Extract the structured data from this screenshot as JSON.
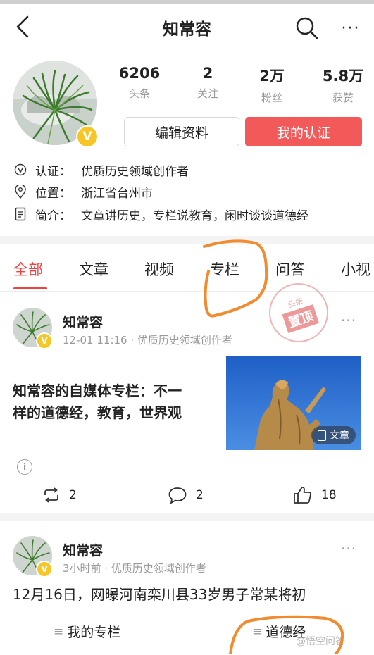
{
  "header": {
    "title": "知常容",
    "back_icon": "chevron-left-icon",
    "search_icon": "search-icon",
    "more_icon": "more-horizontal-icon",
    "more_label": "···"
  },
  "profile": {
    "avatar_badge": "V",
    "stats": [
      {
        "value": "6206",
        "label": "头条"
      },
      {
        "value": "2",
        "label": "关注"
      },
      {
        "value": "2万",
        "label": "粉丝"
      },
      {
        "value": "5.8万",
        "label": "获赞"
      }
    ],
    "edit_button": "编辑资料",
    "cert_button": "我的认证",
    "cert_color": "#f25a5a",
    "info": {
      "cert_key": "认证：",
      "cert_value": "优质历史领域创作者",
      "location_key": "位置：",
      "location_value": "浙江省台州市",
      "bio_key": "简介：",
      "bio_value": "文章讲历史，专栏说教育，闲时谈谈道德经"
    }
  },
  "tabs": [
    {
      "label": "全部",
      "active": true
    },
    {
      "label": "文章",
      "active": false
    },
    {
      "label": "视频",
      "active": false
    },
    {
      "label": "专栏",
      "active": false
    },
    {
      "label": "问答",
      "active": false
    },
    {
      "label": "小视",
      "active": false
    }
  ],
  "accent_color": "#f04142",
  "stamp": {
    "top_text": "头条",
    "main_text": "置顶"
  },
  "post1": {
    "author": "知常容",
    "badge": "V",
    "meta": "12-01 11:16 · 优质历史领域创作者",
    "more": "···",
    "title_line1": "知常容的自媒体专栏：不一",
    "title_line2": "样的道德经，教育，世界观",
    "thumb_label": "文章",
    "info_icon": "i",
    "repost_count": "2",
    "comment_count": "2",
    "like_count": "18"
  },
  "post2": {
    "author": "知常容",
    "badge": "V",
    "meta": "3小时前 · 优质历史领域创作者",
    "more": "···",
    "text": "12月16日，网曝河南栾川县33岁男子常某将初"
  },
  "bottom_bar": {
    "item1_icon": "≡",
    "item1": "我的专栏",
    "item2_icon": "≡",
    "item2": "道德经"
  },
  "watermark": "@悟空问答"
}
